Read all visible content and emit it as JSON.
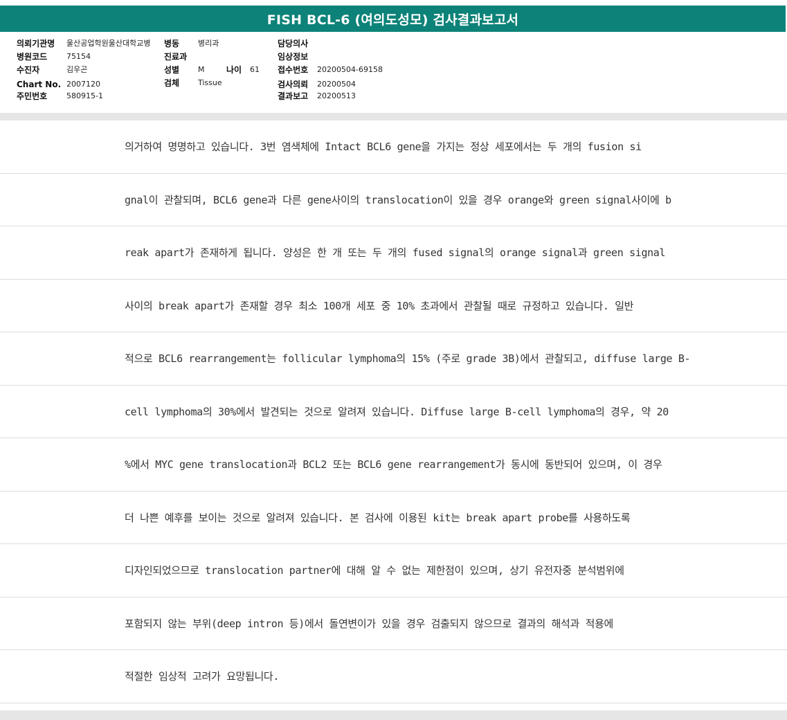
{
  "report": {
    "title": "FISH BCL-6 (여의도성모) 검사결과보고서"
  },
  "header": {
    "institution_label": "의뢰기관명",
    "institution_value": "울산공업학원울산대학교병",
    "ward_label": "병동",
    "ward_value": "병리과",
    "doctor_label": "담당의사",
    "doctor_value": "",
    "hospital_code_label": "병원코드",
    "hospital_code_value": "75154",
    "department_label": "진료과",
    "department_value": "",
    "clinical_info_label": "임상정보",
    "clinical_info_value": "",
    "patient_label": "수진자",
    "patient_value": "김우곤",
    "sex_label": "성별",
    "sex_value": "M",
    "age_label": "나이",
    "age_value": "61",
    "receipt_label": "접수번호",
    "receipt_value": "20200504-69158",
    "chart_label": "Chart No.",
    "chart_value": "2007120",
    "specimen_label": "검체",
    "specimen_value": "Tissue",
    "request_label": "검사의뢰",
    "request_value": "20200504",
    "id_label": "주민번호",
    "id_value": "580915-1",
    "result_label": "결과보고",
    "result_value": "20200513"
  },
  "body_lines": [
    "의거하여 명명하고 있습니다. 3번 염색체에 Intact BCL6 gene을 가지는 정상 세포에서는 두 개의 fusion si",
    "gnal이 관찰되며, BCL6 gene과 다른 gene사이의 translocation이 있을 경우 orange와 green signal사이에 b",
    "reak apart가 존재하게 됩니다. 양성은 한 개 또는 두 개의 fused signal의 orange signal과 green signal",
    "사이의 break apart가 존재할 경우 최소 100개 세포 중 10% 초과에서 관찰될 때로 규정하고 있습니다. 일반",
    "적으로 BCL6 rearrangement는 follicular lymphoma의 15% (주로 grade 3B)에서 관찰되고, diffuse large B-",
    "cell lymphoma의 30%에서 발견되는 것으로 알려져 있습니다. Diffuse large B-cell lymphoma의 경우, 약 20",
    "%에서 MYC gene translocation과 BCL2 또는 BCL6 gene rearrangement가 동시에 동반되어 있으며, 이 경우",
    "더 나쁜 예후를 보이는 것으로 알려져 있습니다. 본 검사에 이용된 kit는 break apart probe를 사용하도록",
    "디자인되었으므로 translocation partner에 대해 알 수 없는 제한점이 있으며, 상기 유전자중 분석범위에",
    "포함되지 않는 부위(deep intron 등)에서 돌연변이가 있을 경우 검출되지 않으므로 결과의 해석과 적용에",
    "적절한 임상적 고려가 요망됩니다."
  ]
}
